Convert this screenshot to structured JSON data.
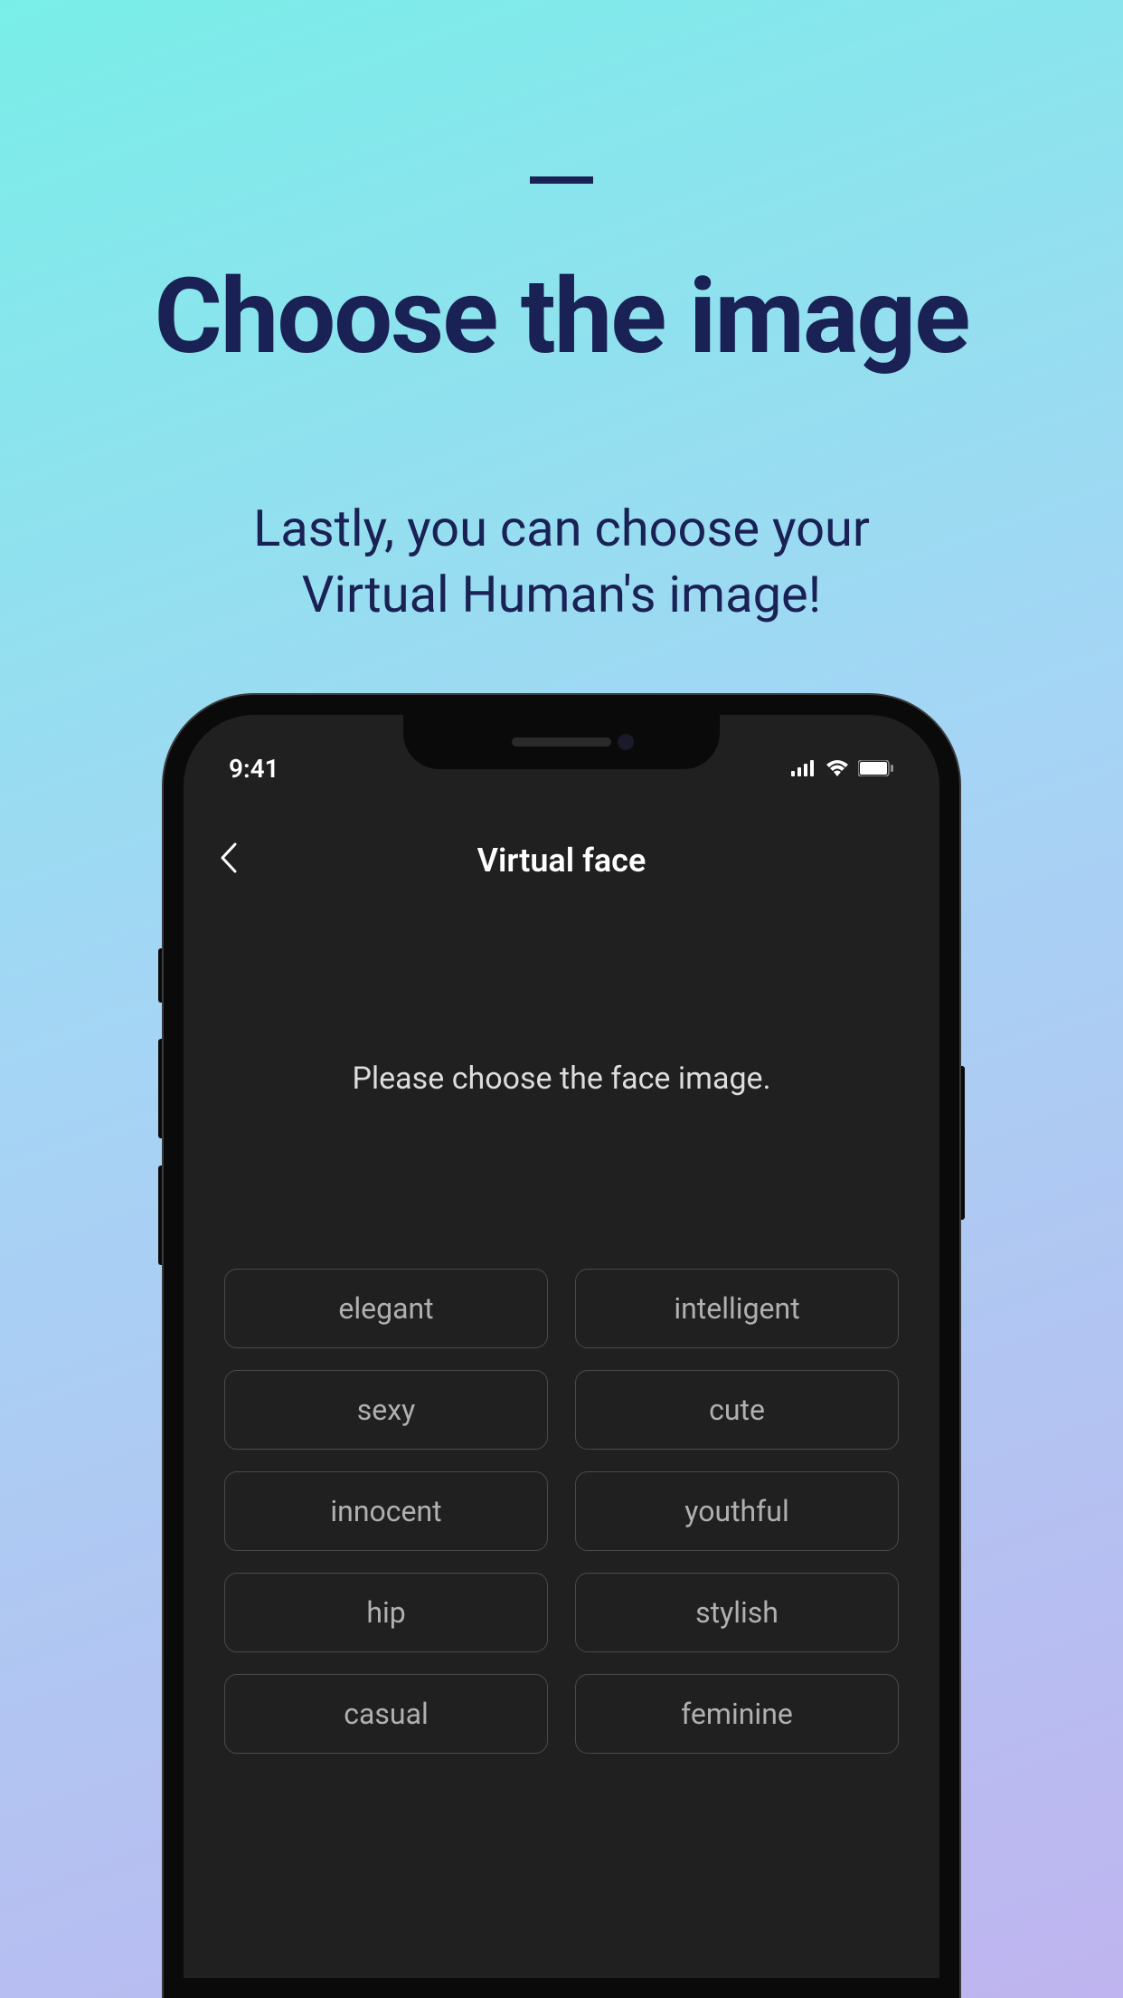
{
  "promo": {
    "title": "Choose the image",
    "subtitle_line1": "Lastly, you can choose your",
    "subtitle_line2": "Virtual Human's image!"
  },
  "status": {
    "time": "9:41"
  },
  "header": {
    "title": "Virtual face"
  },
  "content": {
    "instruction": "Please choose the face image."
  },
  "options": [
    "elegant",
    "intelligent",
    "sexy",
    "cute",
    "innocent",
    "youthful",
    "hip",
    "stylish",
    "casual",
    "feminine"
  ]
}
